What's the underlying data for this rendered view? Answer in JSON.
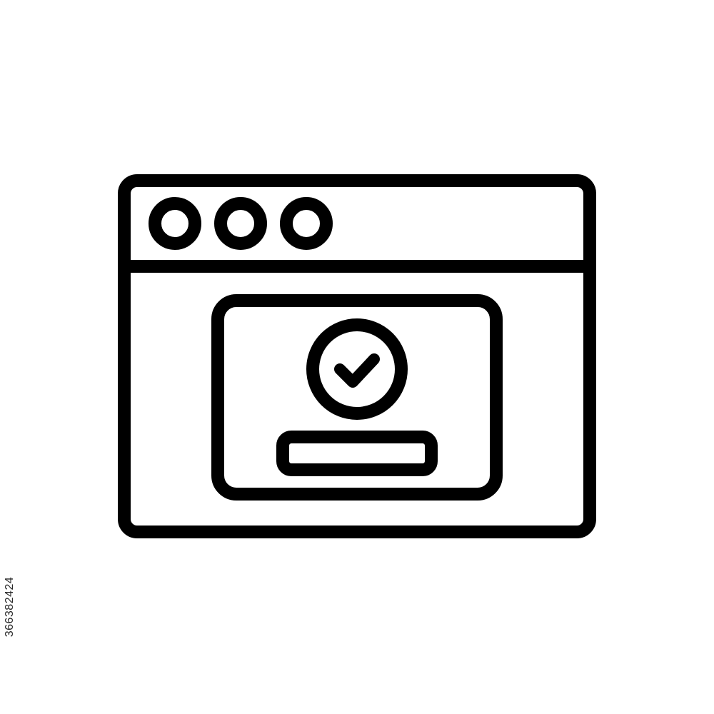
{
  "icon": {
    "name": "browser-window-success-icon",
    "stroke_color": "#000000",
    "background_color": "#ffffff"
  },
  "window": {
    "title_bar_dots": [
      "window-dot-1",
      "window-dot-2",
      "window-dot-3"
    ]
  },
  "dialog": {
    "check_icon": "check-circle-icon",
    "button_icon": "confirm-button-shape"
  },
  "watermark": {
    "stock_id": "366382424"
  }
}
